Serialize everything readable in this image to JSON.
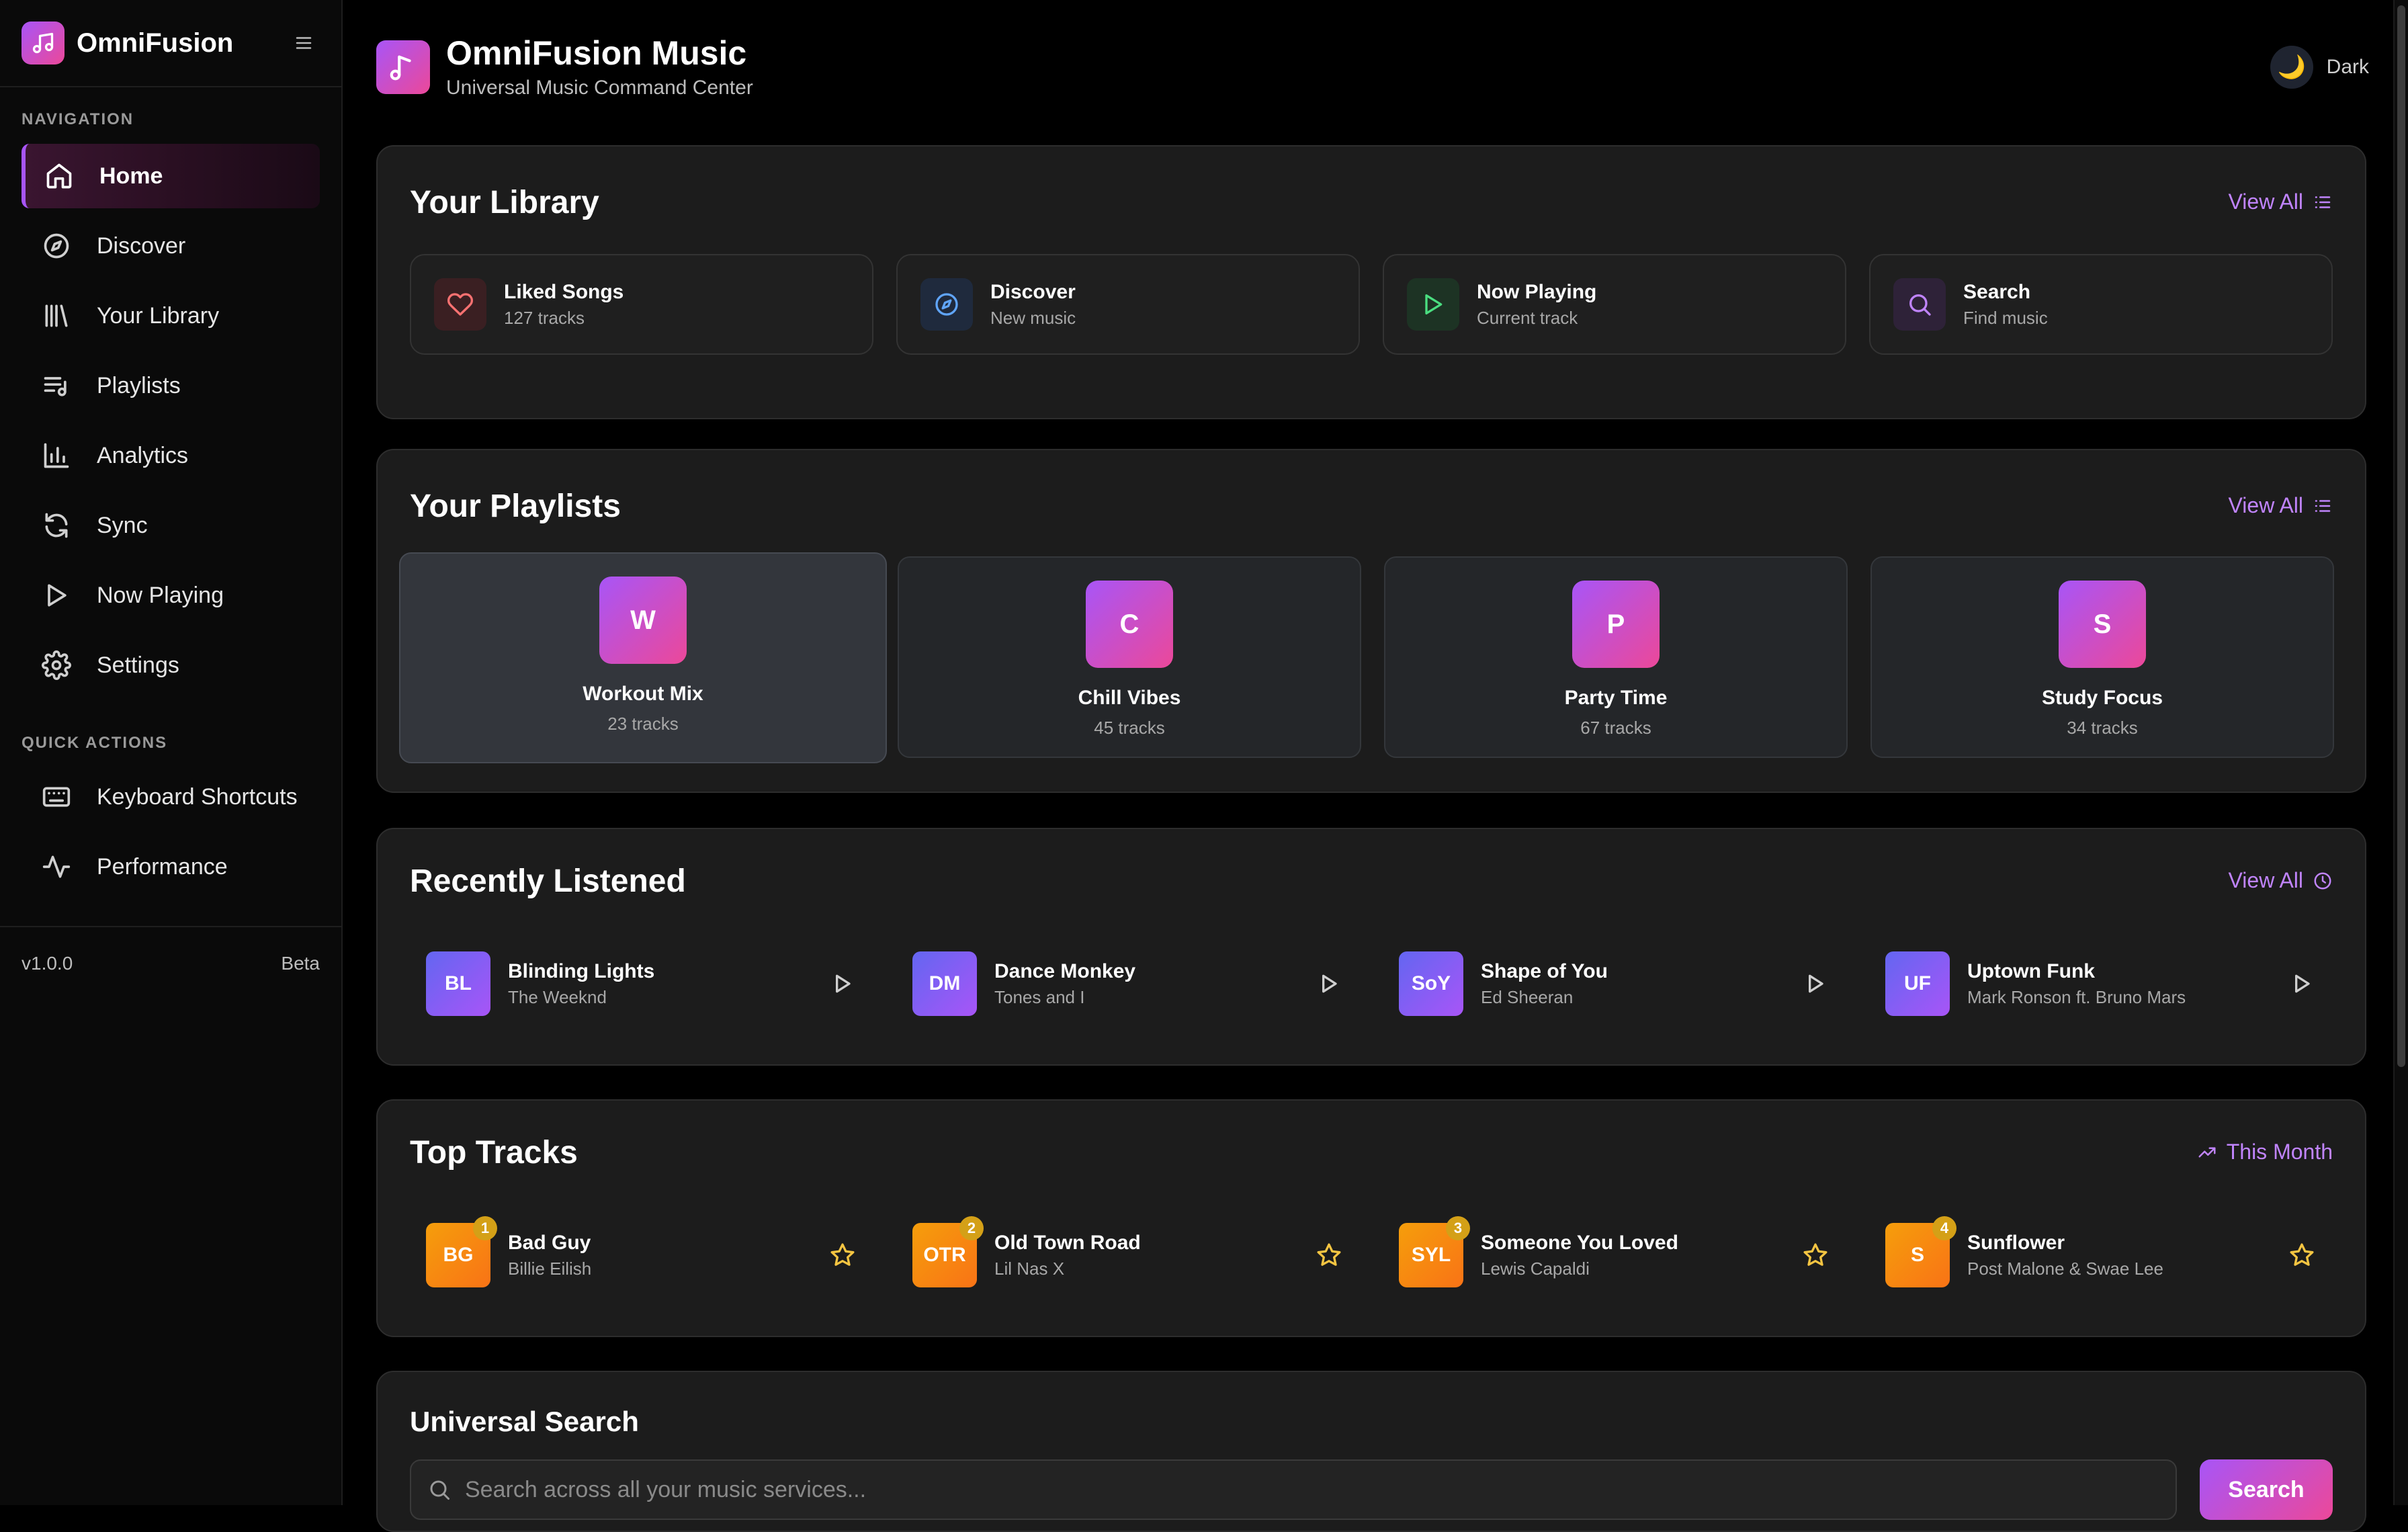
{
  "sidebar": {
    "brand": "OmniFusion",
    "navigation_heading": "NAVIGATION",
    "nav_items": [
      {
        "label": "Home",
        "icon": "home-icon",
        "active": true
      },
      {
        "label": "Discover",
        "icon": "compass-icon"
      },
      {
        "label": "Your Library",
        "icon": "library-icon"
      },
      {
        "label": "Playlists",
        "icon": "playlist-icon"
      },
      {
        "label": "Analytics",
        "icon": "bar-chart-icon"
      },
      {
        "label": "Sync",
        "icon": "sync-icon"
      },
      {
        "label": "Now Playing",
        "icon": "play-icon"
      },
      {
        "label": "Settings",
        "icon": "gear-icon"
      }
    ],
    "quick_actions_heading": "QUICK ACTIONS",
    "quick_actions": [
      {
        "label": "Keyboard Shortcuts",
        "icon": "keyboard-icon"
      },
      {
        "label": "Performance",
        "icon": "activity-icon"
      }
    ],
    "version": "v1.0.0",
    "release": "Beta"
  },
  "header": {
    "title": "OmniFusion Music",
    "subtitle": "Universal Music Command Center",
    "theme_label": "Dark",
    "theme_icon": "🌙"
  },
  "library": {
    "title": "Your Library",
    "view_all": "View All",
    "tiles": [
      {
        "title": "Liked Songs",
        "subtitle": "127 tracks",
        "icon": "heart-icon",
        "color": "#f87171"
      },
      {
        "title": "Discover",
        "subtitle": "New music",
        "icon": "compass-icon",
        "color": "#60a5fa"
      },
      {
        "title": "Now Playing",
        "subtitle": "Current track",
        "icon": "play-icon",
        "color": "#4ade80"
      },
      {
        "title": "Search",
        "subtitle": "Find music",
        "icon": "search-icon",
        "color": "#c084fc"
      }
    ]
  },
  "playlists": {
    "title": "Your Playlists",
    "view_all": "View All",
    "items": [
      {
        "initial": "W",
        "name": "Workout Mix",
        "count": "23 tracks"
      },
      {
        "initial": "C",
        "name": "Chill Vibes",
        "count": "45 tracks"
      },
      {
        "initial": "P",
        "name": "Party Time",
        "count": "67 tracks"
      },
      {
        "initial": "S",
        "name": "Study Focus",
        "count": "34 tracks"
      }
    ]
  },
  "recent": {
    "title": "Recently Listened",
    "view_all": "View All",
    "tracks": [
      {
        "initials": "BL",
        "title": "Blinding Lights",
        "artist": "The Weeknd"
      },
      {
        "initials": "DM",
        "title": "Dance Monkey",
        "artist": "Tones and I"
      },
      {
        "initials": "SoY",
        "title": "Shape of You",
        "artist": "Ed Sheeran"
      },
      {
        "initials": "UF",
        "title": "Uptown Funk",
        "artist": "Mark Ronson ft. Bruno Mars"
      }
    ]
  },
  "top": {
    "title": "Top Tracks",
    "period": "This Month",
    "tracks": [
      {
        "rank": "1",
        "initials": "BG",
        "title": "Bad Guy",
        "artist": "Billie Eilish"
      },
      {
        "rank": "2",
        "initials": "OTR",
        "title": "Old Town Road",
        "artist": "Lil Nas X"
      },
      {
        "rank": "3",
        "initials": "SYL",
        "title": "Someone You Loved",
        "artist": "Lewis Capaldi"
      },
      {
        "rank": "4",
        "initials": "S",
        "title": "Sunflower",
        "artist": "Post Malone & Swae Lee"
      }
    ]
  },
  "search": {
    "title": "Universal Search",
    "placeholder": "Search across all your music services...",
    "button": "Search"
  },
  "colors": {
    "accent": "#a855f7",
    "accent_pink": "#ec4899",
    "link": "#c084fc",
    "rank_badge": "#d4a017"
  }
}
